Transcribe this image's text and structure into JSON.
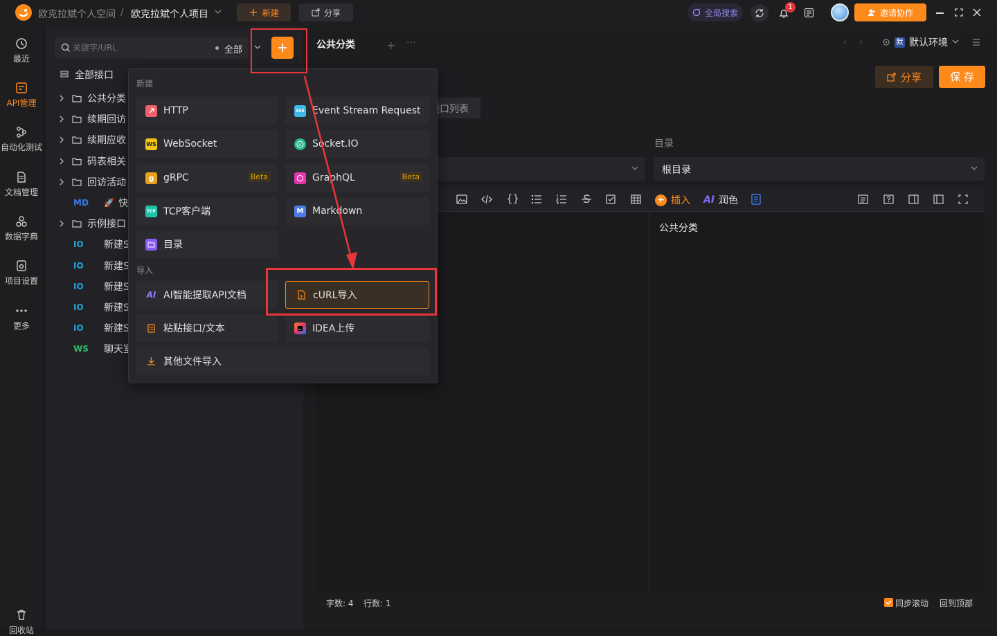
{
  "titlebar": {
    "workspace": "欧克拉斌个人空间",
    "separator": "/",
    "project": "欧克拉斌个人项目",
    "new_label": "新建",
    "share_label": "分享",
    "global_search": "全局搜索",
    "notification_count": "1",
    "invite_label": "邀请协作"
  },
  "rail": {
    "items": [
      {
        "label": "最近",
        "icon": "clock-icon"
      },
      {
        "label": "API管理",
        "icon": "api-icon"
      },
      {
        "label": "自动化测试",
        "icon": "flow-icon"
      },
      {
        "label": "文档管理",
        "icon": "doc-icon"
      },
      {
        "label": "数据字典",
        "icon": "dictionary-icon"
      },
      {
        "label": "项目设置",
        "icon": "settings-icon"
      },
      {
        "label": "更多",
        "icon": "more-icon"
      },
      {
        "label": "回收站",
        "icon": "trash-icon"
      }
    ]
  },
  "tree": {
    "search_placeholder": "关键字/URL",
    "filter_label": "全部",
    "all_label": "全部接口",
    "rows": [
      {
        "type": "folder",
        "label": "公共分类"
      },
      {
        "type": "folder",
        "label": "续期回访"
      },
      {
        "type": "folder",
        "label": "续期应收"
      },
      {
        "type": "folder",
        "label": "码表相关"
      },
      {
        "type": "folder",
        "label": "回访活动"
      },
      {
        "type": "md",
        "method": "MD",
        "label": "快"
      },
      {
        "type": "folder",
        "label": "示例接口"
      },
      {
        "type": "api",
        "method": "IO",
        "label": "新建S"
      },
      {
        "type": "api",
        "method": "IO",
        "label": "新建S"
      },
      {
        "type": "api",
        "method": "IO",
        "label": "新建S"
      },
      {
        "type": "api",
        "method": "IO",
        "label": "新建S"
      },
      {
        "type": "api",
        "method": "IO",
        "label": "新建S"
      },
      {
        "type": "api",
        "method": "WS",
        "label": "聊天室"
      }
    ]
  },
  "tabs": {
    "active": "公共分类"
  },
  "env": {
    "badge": "默",
    "label": "默认环境"
  },
  "main": {
    "share_label": "分享",
    "save_label": "保 存",
    "list_tab": "接口列表",
    "dir_label": "目录",
    "dir_value": "根目录",
    "insert_label": "插入",
    "polish_label": "润色",
    "ai_label": "AI",
    "preview_text": "公共分类",
    "word_count": "字数: 4",
    "line_count": "行数: 1",
    "sync_scroll": "同步滚动",
    "back_top": "回到顶部"
  },
  "popover": {
    "new_section": "新建",
    "import_section": "导入",
    "beta": "Beta",
    "items": {
      "http": "HTTP",
      "sse": "Event Stream Request",
      "websocket": "WebSocket",
      "socketio": "Socket.IO",
      "grpc": "gRPC",
      "graphql": "GraphQL",
      "tcp": "TCP客户端",
      "markdown": "Markdown",
      "folder": "目录",
      "ai_import": "AI智能提取API文档",
      "curl": "cURL导入",
      "paste": "粘贴接口/文本",
      "idea": "IDEA上传",
      "other": "其他文件导入"
    },
    "icon_text": {
      "sse": "SSE",
      "ws": "WS",
      "grpc": "g",
      "tcp": "TCP",
      "md": "M",
      "ai": "AI"
    }
  },
  "colors": {
    "accent": "#ff8a1c",
    "annotation": "#e8363a"
  }
}
